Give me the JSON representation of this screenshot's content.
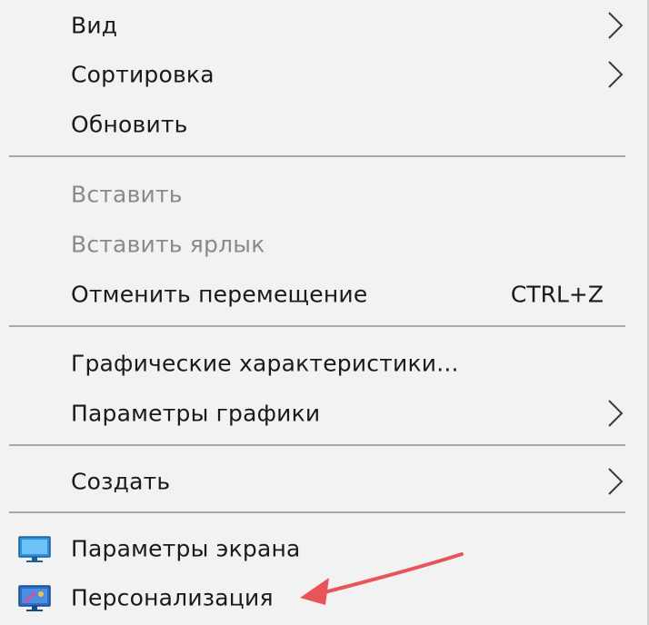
{
  "menu": {
    "items": [
      {
        "label": "Вид",
        "submenu": true,
        "disabled": false
      },
      {
        "label": "Сортировка",
        "submenu": true,
        "disabled": false
      },
      {
        "label": "Обновить",
        "submenu": false,
        "disabled": false
      },
      {
        "label": "Вставить",
        "submenu": false,
        "disabled": true
      },
      {
        "label": "Вставить ярлык",
        "submenu": false,
        "disabled": true
      },
      {
        "label": "Отменить перемещение",
        "shortcut": "CTRL+Z",
        "submenu": false,
        "disabled": false
      },
      {
        "label": "Графические характеристики...",
        "submenu": false,
        "disabled": false
      },
      {
        "label": "Параметры графики",
        "submenu": true,
        "disabled": false
      },
      {
        "label": "Создать",
        "submenu": true,
        "disabled": false
      },
      {
        "label": "Параметры экрана",
        "icon": "display-settings-icon",
        "submenu": false,
        "disabled": false
      },
      {
        "label": "Персонализация",
        "icon": "personalization-icon",
        "submenu": false,
        "disabled": false
      }
    ]
  },
  "colors": {
    "menu_background": "#f2f2f2",
    "text": "#1a1a1a",
    "disabled_text": "#8a8a8a",
    "separator": "#a9a9a9",
    "annotation_arrow": "#e8545a"
  },
  "annotation": {
    "icon": "red-arrow-icon",
    "points_to": "Персонализация"
  }
}
